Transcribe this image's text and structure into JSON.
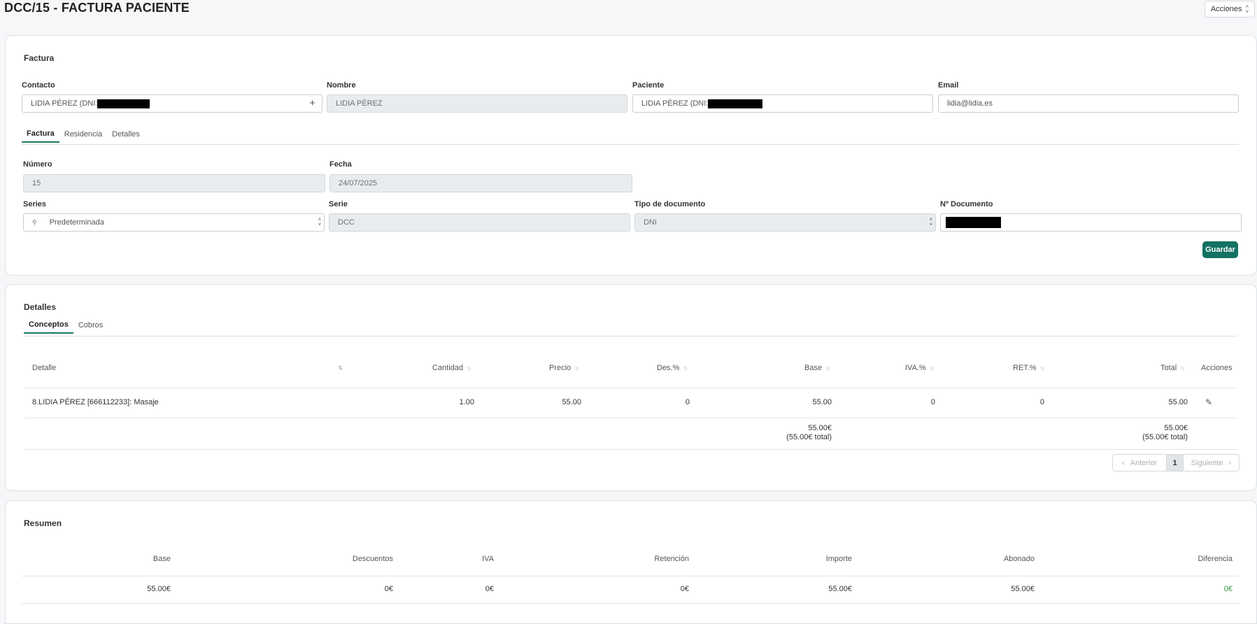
{
  "page": {
    "title": "DCC/15 - FACTURA PACIENTE",
    "acciones_label": "Acciones"
  },
  "factura": {
    "section_title": "Factura",
    "contacto_label": "Contacto",
    "contacto_value": "LIDIA PÉREZ (DNI:",
    "nombre_label": "Nombre",
    "nombre_value": "LIDIA PÉREZ",
    "paciente_label": "Paciente",
    "paciente_value": "LIDIA PÉREZ (DNI:",
    "email_label": "Email",
    "email_value": "lidia@lidia.es",
    "tabs": [
      "Factura",
      "Residencia",
      "Detalles"
    ],
    "numero_label": "Número",
    "numero_value": "15",
    "fecha_label": "Fecha",
    "fecha_value": "24/07/2025",
    "series_label": "Series",
    "series_value": "Predeterminada",
    "serie_label": "Serie",
    "serie_value": "DCC",
    "tipo_doc_label": "Tipo de documento",
    "tipo_doc_value": "DNI",
    "num_doc_label": "Nº Documento",
    "guardar_label": "Guardar"
  },
  "detalles": {
    "section_title": "Detalles",
    "tabs": [
      "Conceptos",
      "Cobros"
    ],
    "columns": [
      "Detalle",
      "Cantidad",
      "Precio",
      "Des.%",
      "Base",
      "IVA.%",
      "RET.%",
      "Total",
      "Acciones"
    ],
    "rows": [
      {
        "detalle": "8.LIDIA PÉREZ [666112233]: Masaje",
        "cantidad": "1.00",
        "precio": "55.00",
        "des": "0",
        "base": "55.00",
        "iva": "0",
        "ret": "0",
        "total": "55.00"
      }
    ],
    "totals": {
      "base_line1": "55.00€",
      "base_line2": "(55.00€ total)",
      "total_line1": "55.00€",
      "total_line2": "(55.00€ total)"
    },
    "pager": {
      "prev": "Anterior",
      "page": "1",
      "next": "Siguiente"
    }
  },
  "resumen": {
    "section_title": "Resumen",
    "labels": {
      "base": "Base",
      "descuentos": "Descuentos",
      "iva": "IVA",
      "retencion": "Retención",
      "importe": "Importe",
      "abonado": "Abonado",
      "diferencia": "Diferencia"
    },
    "values": {
      "base": "55.00€",
      "descuentos": "0€",
      "iva": "0€",
      "retencion": "0€",
      "importe": "55.00€",
      "abonado": "55.00€",
      "diferencia": "0€"
    },
    "diferencia_color": "#2e9a3e"
  },
  "colors": {
    "accent": "#137262",
    "redaction": "#000000"
  }
}
